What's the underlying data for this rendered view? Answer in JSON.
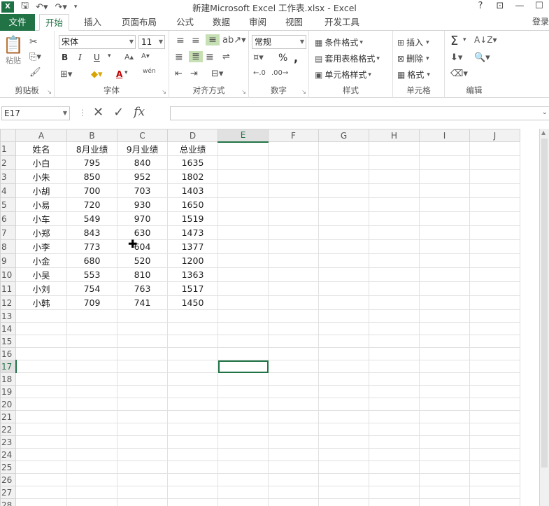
{
  "window": {
    "title": "新建Microsoft Excel 工作表.xlsx - Excel",
    "help": "?",
    "ribbon_display": "⊡",
    "minimize": "—",
    "maximize": "☐",
    "signin": "登录"
  },
  "tabs": [
    "文件",
    "开始",
    "插入",
    "页面布局",
    "公式",
    "数据",
    "审阅",
    "视图",
    "开发工具"
  ],
  "ribbon": {
    "clipboard": {
      "label": "剪贴板",
      "paste": "粘贴"
    },
    "font": {
      "label": "字体",
      "name": "宋体",
      "size": "11",
      "bold": "B",
      "italic": "I",
      "underline": "U",
      "color_letter": "A",
      "phonetic": "wén"
    },
    "alignment": {
      "label": "对齐方式"
    },
    "number": {
      "label": "数字",
      "format": "常规",
      "percent": "%",
      "comma": ","
    },
    "styles": {
      "label": "样式",
      "conditional": "条件格式",
      "table_format": "套用表格格式",
      "cell_style": "单元格样式"
    },
    "cells": {
      "label": "单元格",
      "insert": "插入",
      "delete": "删除",
      "format": "格式"
    },
    "editing": {
      "label": "编辑",
      "sum": "Σ"
    }
  },
  "formula_bar": {
    "name_box": "E17",
    "fx": "fx",
    "value": ""
  },
  "sheet": {
    "columns": [
      "A",
      "B",
      "C",
      "D",
      "E",
      "F",
      "G",
      "H",
      "I",
      "J"
    ],
    "active_col": "E",
    "active_row": 17,
    "header_row": [
      "姓名",
      "8月业绩",
      "9月业绩",
      "总业绩"
    ],
    "rows": [
      [
        "小白",
        "795",
        "840",
        "1635"
      ],
      [
        "小朱",
        "850",
        "952",
        "1802"
      ],
      [
        "小胡",
        "700",
        "703",
        "1403"
      ],
      [
        "小易",
        "720",
        "930",
        "1650"
      ],
      [
        "小车",
        "549",
        "970",
        "1519"
      ],
      [
        "小郑",
        "843",
        "630",
        "1473"
      ],
      [
        "小李",
        "773",
        "604",
        "1377"
      ],
      [
        "小金",
        "680",
        "520",
        "1200"
      ],
      [
        "小吴",
        "553",
        "810",
        "1363"
      ],
      [
        "小刘",
        "754",
        "763",
        "1517"
      ],
      [
        "小韩",
        "709",
        "741",
        "1450"
      ]
    ],
    "total_rows": 29
  }
}
